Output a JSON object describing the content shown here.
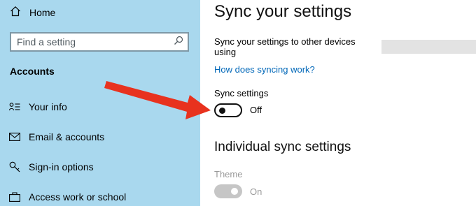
{
  "sidebar": {
    "home_label": "Home",
    "home_icon": "home-icon",
    "search_placeholder": "Find a setting",
    "search_icon": "search-icon",
    "section_title": "Accounts",
    "items": [
      {
        "label": "Your info",
        "icon": "person-card-icon"
      },
      {
        "label": "Email & accounts",
        "icon": "envelope-icon"
      },
      {
        "label": "Sign-in options",
        "icon": "key-icon"
      },
      {
        "label": "Access work or school",
        "icon": "briefcase-icon"
      }
    ]
  },
  "main": {
    "title": "Sync your settings",
    "description": "Sync your settings to other devices using",
    "link": "How does syncing work?",
    "sync_label": "Sync settings",
    "sync_state": "Off",
    "individual_heading": "Individual sync settings",
    "theme_label": "Theme",
    "theme_state": "On"
  },
  "colors": {
    "sidebar_bg": "#a9d8ee",
    "link": "#0067b8",
    "arrow": "#e8321e"
  }
}
